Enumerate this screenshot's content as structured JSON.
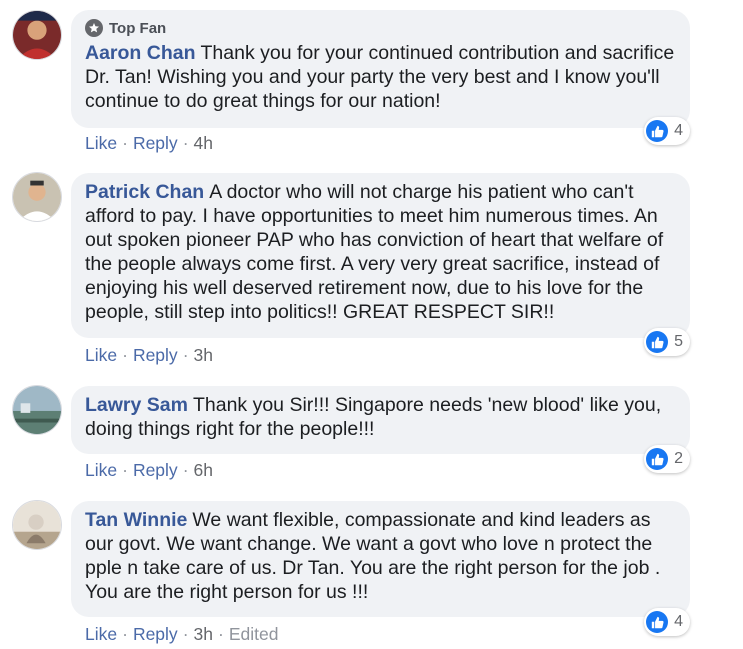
{
  "comments": [
    {
      "badge": "Top Fan",
      "author": "Aaron Chan",
      "text": "Thank you for your continued contribution and sacrifice Dr. Tan! Wishing you and your party the very best and I know you'll continue to do great things for our nation!",
      "like_label": "Like",
      "reply_label": "Reply",
      "time": "4h",
      "reaction_count": "4"
    },
    {
      "author": "Patrick Chan",
      "text": "A doctor who will not charge his patient who can't afford to pay. I have opportunities to meet him numerous times. An out spoken pioneer PAP who has conviction of heart that welfare of the people always come first. A very very great sacrifice, instead of enjoying his well deserved retirement now, due to his love for the people, still step into politics!! GREAT RESPECT SIR!!",
      "like_label": "Like",
      "reply_label": "Reply",
      "time": "3h",
      "reaction_count": "5"
    },
    {
      "author": "Lawry Sam",
      "text": "Thank you Sir!!! Singapore needs 'new blood' like you, doing things right for the people!!!",
      "like_label": "Like",
      "reply_label": "Reply",
      "time": "6h",
      "reaction_count": "2"
    },
    {
      "author": "Tan Winnie",
      "text": "We want flexible, compassionate and kind leaders as our govt. We want change. We want a govt who love n protect the pple n take care of us. Dr Tan. You are the right person for the job . You are the right person for us !!!",
      "like_label": "Like",
      "reply_label": "Reply",
      "time": "3h",
      "edited": "Edited",
      "reaction_count": "4"
    }
  ],
  "colors": {
    "author": "#385898",
    "bubble": "#f0f2f5",
    "like_blue": "#1877f2",
    "meta": "#65676b"
  }
}
